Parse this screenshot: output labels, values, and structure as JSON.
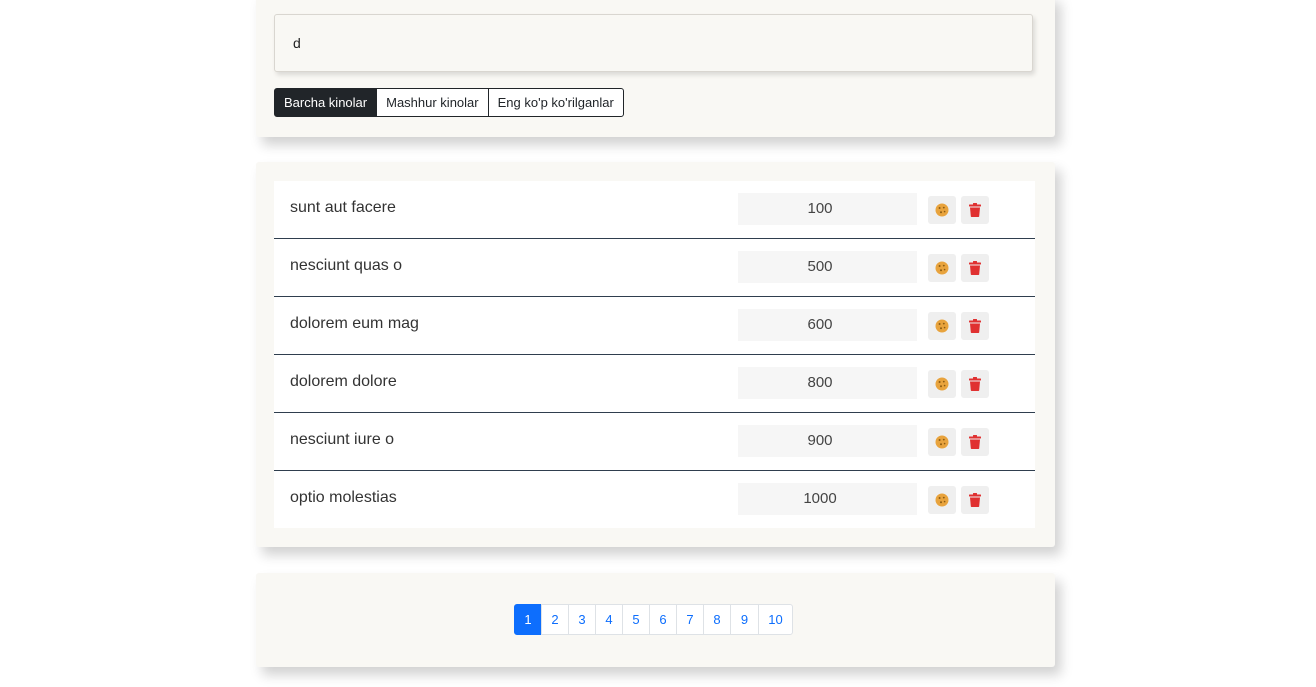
{
  "search": {
    "value": "d",
    "placeholder": ""
  },
  "filters": [
    {
      "label": "Barcha kinolar",
      "active": true
    },
    {
      "label": "Mashhur kinolar",
      "active": false
    },
    {
      "label": "Eng ko'p ko'rilganlar",
      "active": false
    }
  ],
  "movies": [
    {
      "title": "sunt aut facere",
      "views": "100"
    },
    {
      "title": "nesciunt quas o",
      "views": "500"
    },
    {
      "title": "dolorem eum mag",
      "views": "600"
    },
    {
      "title": "dolorem dolore",
      "views": "800"
    },
    {
      "title": "nesciunt iure o",
      "views": "900"
    },
    {
      "title": "optio molestias",
      "views": "1000"
    }
  ],
  "row_icons": {
    "like": "cookie-icon",
    "delete": "trash-icon"
  },
  "colors": {
    "cookie": "#e8a33d",
    "trash": "#e03131",
    "active_page": "#0d6efd",
    "active_filter": "#212529"
  },
  "pagination": {
    "pages": [
      "1",
      "2",
      "3",
      "4",
      "5",
      "6",
      "7",
      "8",
      "9",
      "10"
    ],
    "active": "1"
  }
}
